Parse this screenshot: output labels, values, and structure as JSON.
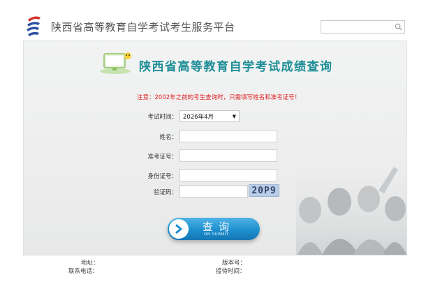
{
  "header": {
    "site_title": "陕西省高等教育自学考试考生服务平台",
    "search_placeholder": ""
  },
  "main": {
    "title": "陕西省高等教育自学考试成绩查询",
    "notice": "注意：2002年之前的考生查询时，只需填写姓名和准考证号！",
    "form": {
      "exam_time_label": "考试时间：",
      "exam_time_value": "2026年4月",
      "name_label": "姓名：",
      "ticket_label": "准考证号：",
      "id_label": "身份证号：",
      "captcha_label": "验证码：",
      "captcha_text": "20P9"
    },
    "submit": {
      "label": "查询",
      "sub_label": "ON SUBMIT"
    }
  },
  "footer": {
    "address_label": "地址：",
    "phone_label": "联系电话：",
    "version_label": "版本号：",
    "hours_label": "接待时间："
  },
  "colors": {
    "title": "#1f8f97",
    "notice": "#e02020",
    "button": "#1d8fcf"
  }
}
